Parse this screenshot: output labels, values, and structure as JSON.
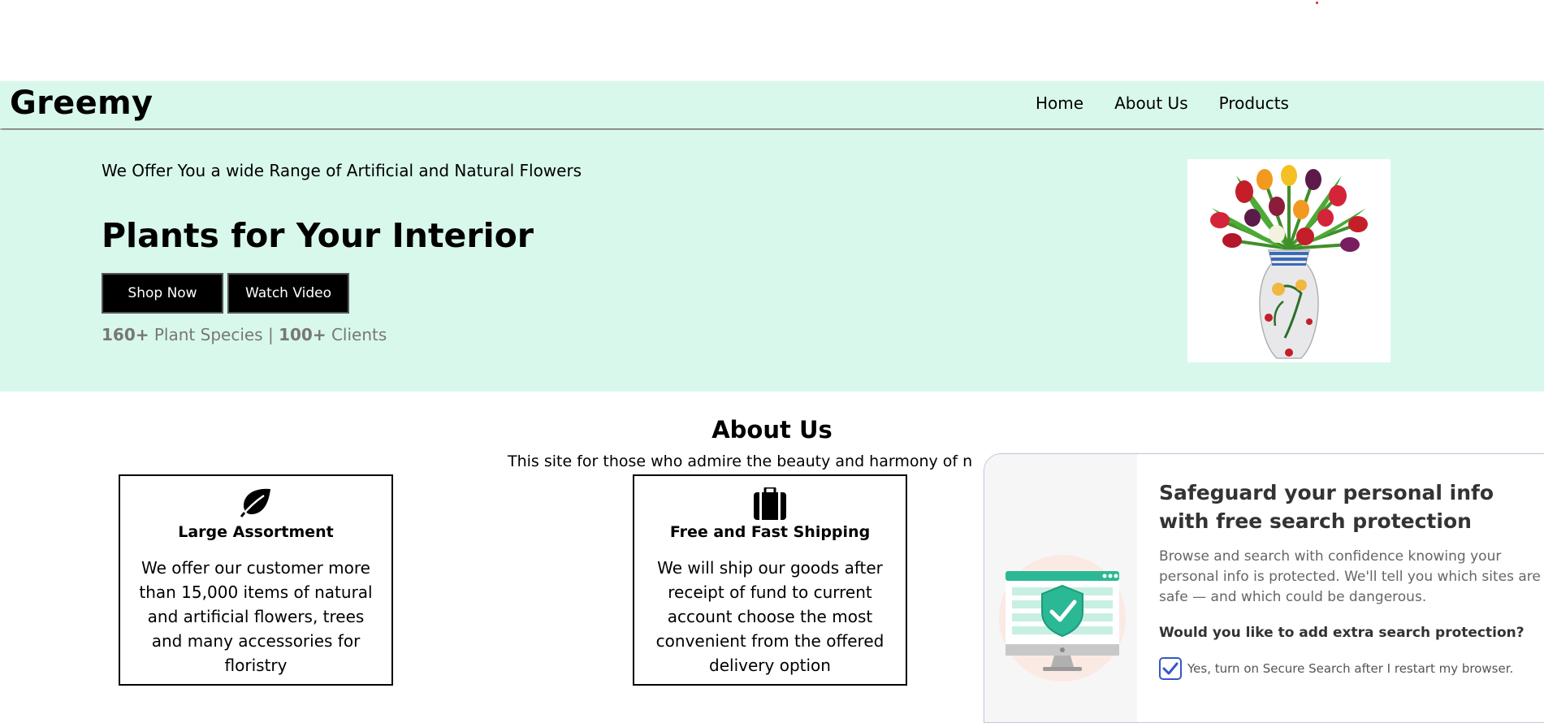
{
  "header": {
    "brand": "Greemy",
    "nav": [
      "Home",
      "About Us",
      "Products"
    ]
  },
  "hero": {
    "tagline": "We Offer You a wide Range of Artificial and Natural Flowers",
    "title": "Plants for Your Interior",
    "buttons": {
      "shop": "Shop Now",
      "video": "Watch Video"
    },
    "stats": {
      "species_count": "160+",
      "species_label": "Plant Species",
      "separator": "|",
      "clients_count": "100+",
      "clients_label": "Clients"
    },
    "image": "tulips-vase-image"
  },
  "about": {
    "title": "About Us",
    "subtitle": "This site for those who admire the beauty and harmony of n",
    "cards": [
      {
        "icon": "leaf-icon",
        "title": "Large Assortment",
        "text": "We offer our customer more than 15,000 items of natural and artificial flowers, trees and many accessories for floristry"
      },
      {
        "icon": "suitcase-icon",
        "title": "Free and Fast Shipping",
        "text": "We will ship our goods after receipt of fund to current account choose the most convenient from the offered delivery option"
      }
    ]
  },
  "popup": {
    "title": "Safeguard your personal info with free search protection",
    "description": "Browse and search with confidence knowing your personal info is protected. We'll tell you which sites are safe — and which could be dangerous.",
    "question": "Would you like to add extra search protection?",
    "checkbox_label": "Yes, turn on Secure Search after I restart my browser.",
    "checkbox_checked": true,
    "illustration": "monitor-shield-check-icon"
  },
  "colors": {
    "mint_background": "#d9f8ec",
    "button_black": "#000000",
    "checkbox_blue": "#3657c8",
    "shield_green": "#2bb894"
  }
}
